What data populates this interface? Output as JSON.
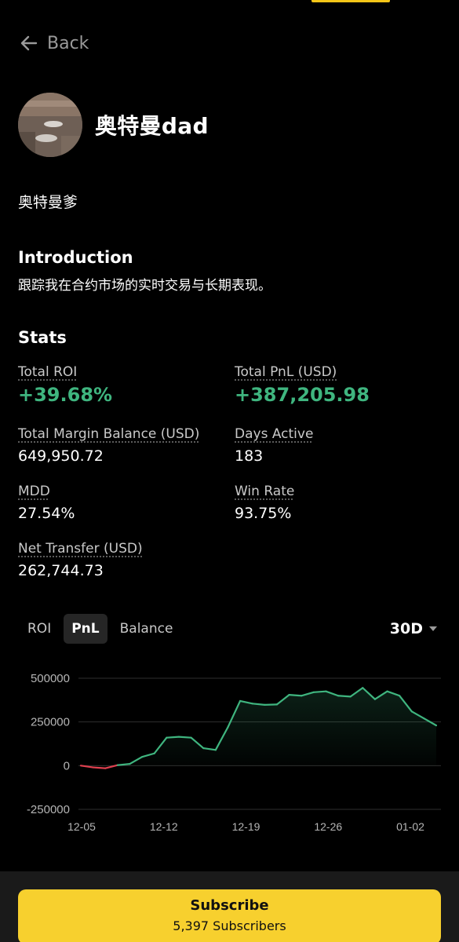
{
  "nav": {
    "back_label": "Back"
  },
  "profile": {
    "name": "奥特曼dad",
    "nickname": "奥特曼爹"
  },
  "introduction": {
    "title": "Introduction",
    "text": "跟踪我在合约市场的实时交易与长期表现。"
  },
  "stats": {
    "title": "Stats",
    "total_roi": {
      "label": "Total ROI",
      "value": "+39.68%"
    },
    "total_pnl": {
      "label": "Total PnL (USD)",
      "value": "+387,205.98"
    },
    "total_margin_balance": {
      "label": "Total Margin Balance (USD)",
      "value": "649,950.72"
    },
    "days_active": {
      "label": "Days Active",
      "value": "183"
    },
    "mdd": {
      "label": "MDD",
      "value": "27.54%"
    },
    "win_rate": {
      "label": "Win Rate",
      "value": "93.75%"
    },
    "net_transfer": {
      "label": "Net Transfer (USD)",
      "value": "262,744.73"
    }
  },
  "chart_tabs": {
    "roi": "ROI",
    "pnl": "PnL",
    "balance": "Balance",
    "active": "PnL"
  },
  "period": "30D",
  "colors": {
    "positive": "#3fb57f",
    "negative": "#e0404f",
    "accent": "#f7d02e"
  },
  "chart_data": {
    "type": "area",
    "x_labels": [
      "12-05",
      "12-12",
      "12-19",
      "12-26",
      "01-02"
    ],
    "y_ticks": [
      500000,
      250000,
      0,
      -250000
    ],
    "y_tick_labels": [
      "500000",
      "250000",
      "0",
      "-250000"
    ],
    "ylim": [
      -250000,
      500000
    ],
    "grid": true,
    "series": [
      {
        "values": [
          0,
          -10000,
          -15000,
          3000,
          10000,
          50000,
          70000,
          160000,
          165000,
          160000,
          100000,
          90000,
          220000,
          370000,
          355000,
          348000,
          350000,
          405000,
          400000,
          420000,
          425000,
          400000,
          395000,
          445000,
          380000,
          425000,
          400000,
          310000,
          270000,
          230000
        ]
      }
    ]
  },
  "subscribe": {
    "label": "Subscribe",
    "count_text": "5,397 Subscribers"
  }
}
